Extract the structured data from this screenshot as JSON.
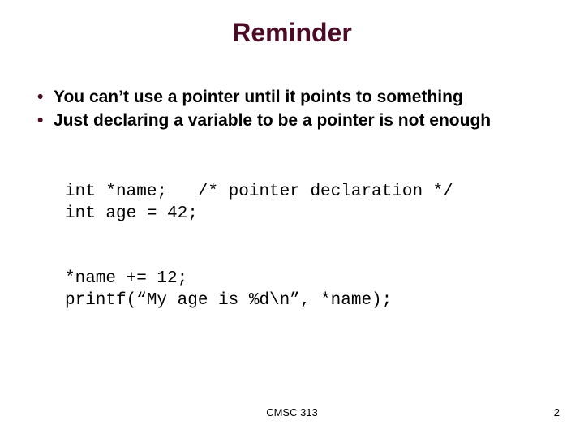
{
  "title": "Reminder",
  "bullets": [
    "You can’t use a pointer until it points to something",
    "Just declaring a variable to be a pointer is not enough"
  ],
  "code": {
    "line1": "int *name;   /* pointer declaration */",
    "line2": "int age = 42;",
    "line3": "*name += 12;",
    "line4": "printf(“My age is %d\\n”, *name);"
  },
  "footer": {
    "course": "CMSC 313",
    "page": "2"
  }
}
